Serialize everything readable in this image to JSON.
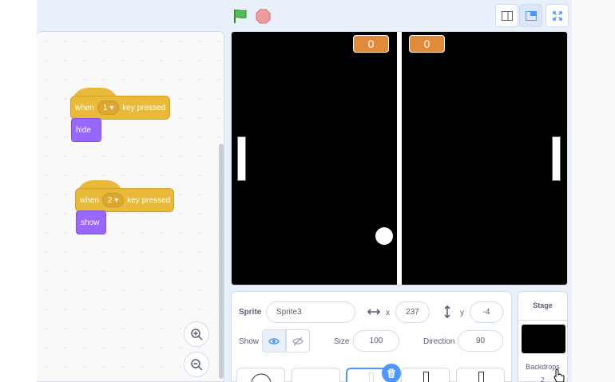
{
  "header": {
    "green_flag_icon": "green-flag-icon",
    "stop_icon": "stop-icon",
    "view_buttons": [
      "small-stage-icon",
      "normal-stage-icon",
      "fullscreen-icon"
    ]
  },
  "code": {
    "script1": {
      "hat_when": "when",
      "hat_key": "1",
      "hat_suffix": "key pressed",
      "action": "hide"
    },
    "script2": {
      "hat_when": "when",
      "hat_key": "2",
      "hat_suffix": "key pressed",
      "action": "show"
    }
  },
  "stage": {
    "score_left": "0",
    "score_right": "0"
  },
  "sprite_info": {
    "sprite_label": "Sprite",
    "sprite_name": "Sprite3",
    "x_label": "x",
    "x_value": "237",
    "y_label": "y",
    "y_value": "-4",
    "show_label": "Show",
    "size_label": "Size",
    "size_value": "100",
    "direction_label": "Direction",
    "direction_value": "90"
  },
  "stage_panel": {
    "title": "Stage",
    "backdrops_label": "Backdrops",
    "backdrops_count": "2"
  },
  "colors": {
    "event_block": "#e9b93a",
    "looks_block": "#9966ff",
    "score_box": "#e18a3a",
    "accent": "#4c97ff"
  }
}
